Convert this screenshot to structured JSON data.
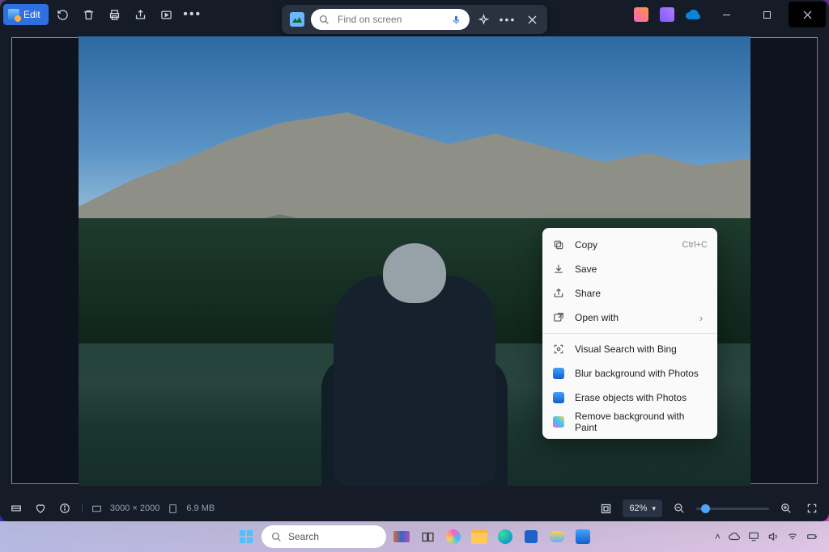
{
  "toolbar": {
    "edit_label": "Edit"
  },
  "search_pill": {
    "placeholder": "Find on screen"
  },
  "context_menu": {
    "items": [
      {
        "label": "Copy",
        "shortcut": "Ctrl+C",
        "icon": "copy"
      },
      {
        "label": "Save",
        "icon": "save"
      },
      {
        "label": "Share",
        "icon": "share"
      },
      {
        "label": "Open with",
        "icon": "openwith",
        "submenu": true,
        "sep_after": true
      },
      {
        "label": "Visual Search with Bing",
        "icon": "visual"
      },
      {
        "label": "Blur background with Photos",
        "icon": "photos"
      },
      {
        "label": "Erase objects with Photos",
        "icon": "photos2"
      },
      {
        "label": "Remove background with Paint",
        "icon": "paint"
      }
    ]
  },
  "status": {
    "dimensions": "3000 × 2000",
    "filesize": "6.9 MB",
    "zoom": "62%"
  },
  "taskbar": {
    "search_label": "Search"
  }
}
